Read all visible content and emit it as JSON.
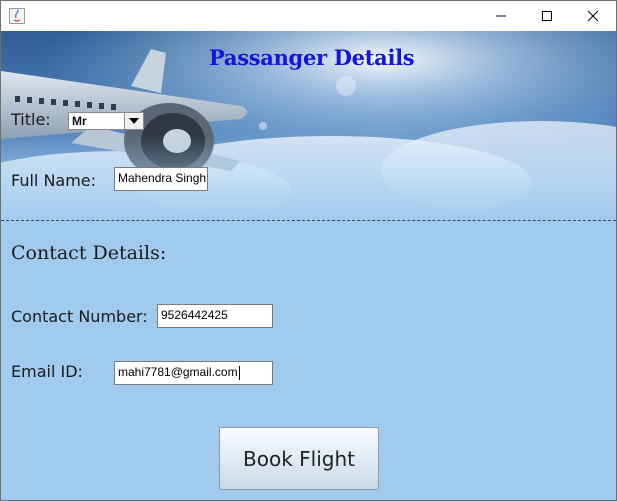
{
  "window": {
    "controls": {
      "minimize_icon": "minimize-icon",
      "maximize_icon": "maximize-icon",
      "close_icon": "close-icon"
    }
  },
  "header": {
    "title": "Passanger Details"
  },
  "form": {
    "title_label": "Title:",
    "title_value": "Mr",
    "fullname_label": "Full Name:",
    "fullname_value": "Mahendra Singh",
    "contact_section_title": "Contact Details:",
    "contact_number_label": "Contact Number:",
    "contact_number_value": "9526442425",
    "email_label": "Email ID:",
    "email_value": "mahi7781@gmail.com"
  },
  "actions": {
    "book_label": "Book Flight"
  },
  "colors": {
    "title": "#1414dc",
    "background": "#a0cbee"
  }
}
